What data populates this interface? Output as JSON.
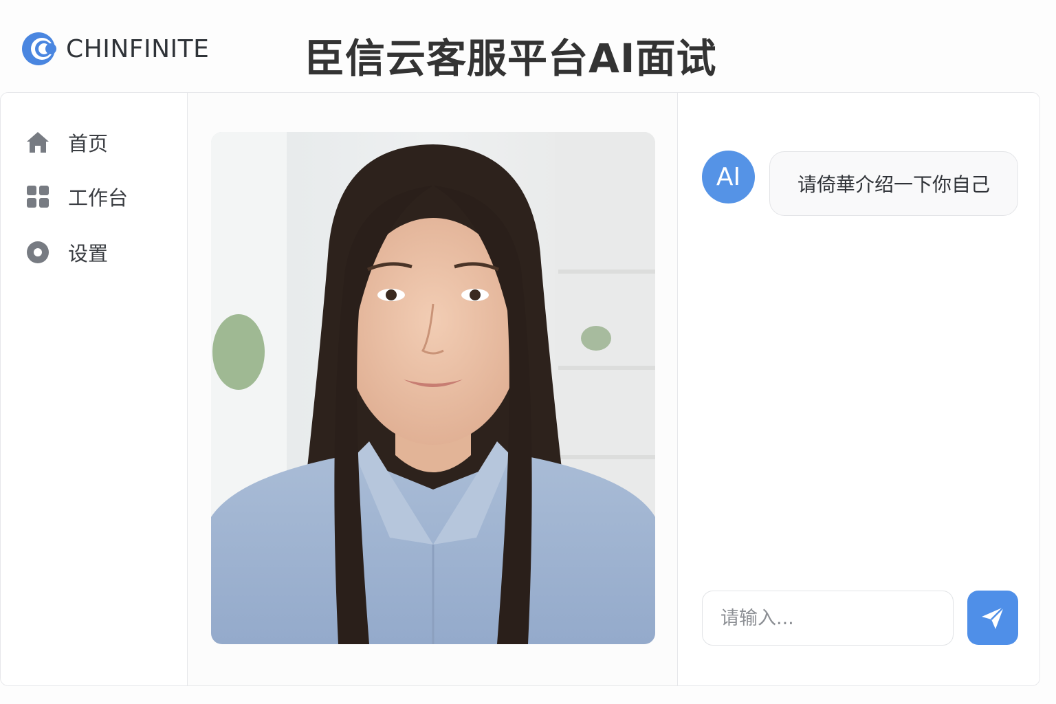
{
  "header": {
    "brand": "CHINFINITE",
    "title": "臣信云客服平台AI面试"
  },
  "sidebar": {
    "items": [
      {
        "label": "首页",
        "icon": "home-icon"
      },
      {
        "label": "工作台",
        "icon": "grid-icon"
      },
      {
        "label": "设置",
        "icon": "settings-icon"
      }
    ]
  },
  "video": {
    "description_icon": "person-video-feed"
  },
  "chat": {
    "avatar_label": "AI",
    "messages": [
      {
        "sender": "AI",
        "text": "请倚華介绍一下你自己"
      }
    ],
    "input_placeholder": "请输入...",
    "send_icon": "send-icon"
  },
  "colors": {
    "accent": "#4f8fe8",
    "avatar": "#5593e6",
    "icon_gray": "#7a7e85",
    "border": "#e6e7ea"
  }
}
